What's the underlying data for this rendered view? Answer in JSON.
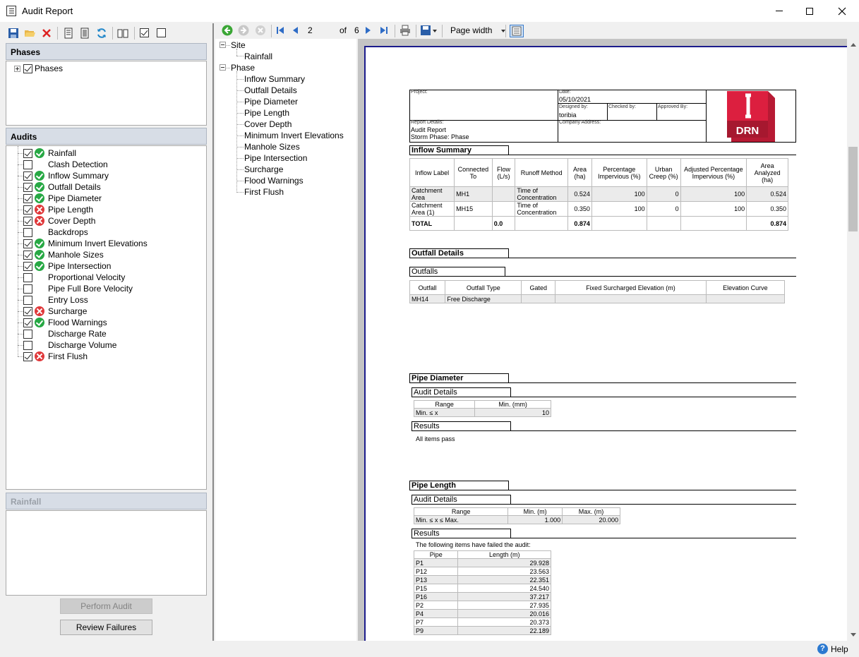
{
  "window": {
    "title": "Audit Report"
  },
  "phases_panel": {
    "header": "Phases",
    "root": "Phases"
  },
  "audits_panel": {
    "header": "Audits",
    "items": [
      {
        "label": "Rainfall",
        "checked": true,
        "status": "pass"
      },
      {
        "label": "Clash Detection",
        "checked": false,
        "status": "none"
      },
      {
        "label": "Inflow Summary",
        "checked": true,
        "status": "pass"
      },
      {
        "label": "Outfall Details",
        "checked": true,
        "status": "pass"
      },
      {
        "label": "Pipe Diameter",
        "checked": true,
        "status": "pass"
      },
      {
        "label": "Pipe Length",
        "checked": true,
        "status": "fail"
      },
      {
        "label": "Cover Depth",
        "checked": true,
        "status": "fail"
      },
      {
        "label": "Backdrops",
        "checked": false,
        "status": "none"
      },
      {
        "label": "Minimum Invert Elevations",
        "checked": true,
        "status": "pass"
      },
      {
        "label": "Manhole Sizes",
        "checked": true,
        "status": "pass"
      },
      {
        "label": "Pipe Intersection",
        "checked": true,
        "status": "pass"
      },
      {
        "label": "Proportional Velocity",
        "checked": false,
        "status": "none"
      },
      {
        "label": "Pipe Full Bore Velocity",
        "checked": false,
        "status": "none"
      },
      {
        "label": "Entry Loss",
        "checked": false,
        "status": "none"
      },
      {
        "label": "Surcharge",
        "checked": true,
        "status": "fail"
      },
      {
        "label": "Flood Warnings",
        "checked": true,
        "status": "pass"
      },
      {
        "label": "Discharge Rate",
        "checked": false,
        "status": "none"
      },
      {
        "label": "Discharge Volume",
        "checked": false,
        "status": "none"
      },
      {
        "label": "First Flush",
        "checked": true,
        "status": "fail"
      }
    ]
  },
  "detail_panel": {
    "header": "Rainfall"
  },
  "buttons": {
    "perform_audit": "Perform Audit",
    "review_failures": "Review Failures"
  },
  "report_toolbar": {
    "page": "2",
    "of_label": "of",
    "page_count": "6",
    "zoom": "Page width"
  },
  "doc_map": {
    "site": "Site",
    "site_children": [
      "Rainfall"
    ],
    "phase": "Phase",
    "phase_children": [
      "Inflow Summary",
      "Outfall Details",
      "Pipe Diameter",
      "Pipe Length",
      "Cover Depth",
      "Minimum Invert Elevations",
      "Manhole Sizes",
      "Pipe Intersection",
      "Surcharge",
      "Flood Warnings",
      "First Flush"
    ]
  },
  "report": {
    "header": {
      "project_label": "Project:",
      "date_label": "Date:",
      "date": "05/10/2021",
      "designed_by_label": "Designed by:",
      "designed_by": "toribia",
      "checked_by_label": "Checked by:",
      "approved_by_label": "Approved By:",
      "report_details_label": "Report Details:",
      "report_line1": "Audit Report",
      "report_line2": "Storm Phase: Phase",
      "company_address_label": "Company Address:",
      "logo_letter": "I",
      "logo_text": "DRN"
    },
    "inflow_summary": {
      "title": "Inflow Summary",
      "headers": [
        "Inflow Label",
        "Connected To",
        "Flow (L/s)",
        "Runoff Method",
        "Area (ha)",
        "Percentage Impervious (%)",
        "Urban Creep (%)",
        "Adjusted Percentage Impervious (%)",
        "Area Analyzed (ha)"
      ],
      "rows": [
        [
          "Catchment Area",
          "MH1",
          "",
          "Time of Concentration",
          "0.524",
          "100",
          "0",
          "100",
          "0.524"
        ],
        [
          "Catchment Area (1)",
          "MH15",
          "",
          "Time of Concentration",
          "0.350",
          "100",
          "0",
          "100",
          "0.350"
        ]
      ],
      "total": [
        "TOTAL",
        "",
        "0.0",
        "",
        "0.874",
        "",
        "",
        "",
        "0.874"
      ]
    },
    "outfall_details": {
      "title": "Outfall Details",
      "subtitle": "Outfalls",
      "headers": [
        "Outfall",
        "Outfall Type",
        "Gated",
        "Fixed Surcharged Elevation (m)",
        "Elevation Curve"
      ],
      "rows": [
        [
          "MH14",
          "Free Discharge",
          "",
          "",
          ""
        ]
      ]
    },
    "pipe_diameter": {
      "title": "Pipe Diameter",
      "audit_details": "Audit Details",
      "headers": [
        "Range",
        "Min. (mm)"
      ],
      "rows": [
        [
          "Min. ≤ x",
          "10"
        ]
      ],
      "results": "Results",
      "results_text": "All items pass"
    },
    "pipe_length": {
      "title": "Pipe Length",
      "audit_details": "Audit Details",
      "headers": [
        "Range",
        "Min. (m)",
        "Max. (m)"
      ],
      "rows": [
        [
          "Min. ≤ x ≤ Max.",
          "1.000",
          "20.000"
        ]
      ],
      "results": "Results",
      "results_text": "The following items have failed the audit:",
      "fail_headers": [
        "Pipe",
        "Length (m)"
      ],
      "fail_rows": [
        [
          "P1",
          "29.928"
        ],
        [
          "P12",
          "23.563"
        ],
        [
          "P13",
          "22.351"
        ],
        [
          "P15",
          "24.540"
        ],
        [
          "P16",
          "37.217"
        ],
        [
          "P2",
          "27.935"
        ],
        [
          "P4",
          "20.016"
        ],
        [
          "P7",
          "20.373"
        ],
        [
          "P9",
          "22.189"
        ]
      ]
    }
  },
  "statusbar": {
    "help": "Help"
  },
  "colors": {
    "pass": "#27a844",
    "fail": "#e0383a",
    "logo": "#dc1f3f",
    "accent": "#1c1c8c"
  }
}
